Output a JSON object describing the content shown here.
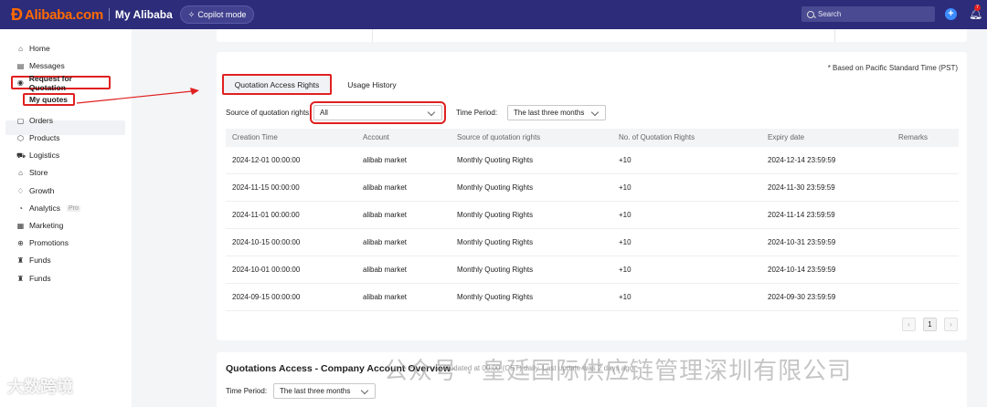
{
  "header": {
    "brand_mark": "Ɖ",
    "brand": "Alibaba.com",
    "title": "My Alibaba",
    "copilot_label": "Copilot mode",
    "search_placeholder": "Search",
    "notification_count": "7"
  },
  "sidebar": {
    "items": [
      {
        "label": "Home",
        "icon": "home-icon"
      },
      {
        "label": "Messages",
        "icon": "messages-icon"
      },
      {
        "label": "Request for Quotation",
        "icon": "rfq-icon"
      },
      {
        "label": "My quotes"
      },
      {
        "label": "Orders",
        "icon": "orders-icon"
      },
      {
        "label": "Products",
        "icon": "products-icon"
      },
      {
        "label": "Logistics",
        "icon": "logistics-icon"
      },
      {
        "label": "Store",
        "icon": "store-icon"
      },
      {
        "label": "Growth",
        "icon": "growth-icon"
      },
      {
        "label": "Analytics",
        "icon": "analytics-icon",
        "badge": "Pro"
      },
      {
        "label": "Marketing",
        "icon": "marketing-icon"
      },
      {
        "label": "Promotions",
        "icon": "promotions-icon"
      },
      {
        "label": "Funds",
        "icon": "funds-icon"
      },
      {
        "label": "Funds",
        "icon": "funds-icon"
      }
    ]
  },
  "main": {
    "pst_note": "* Based on Pacific Standard Time (PST)",
    "tabs": [
      {
        "label": "Quotation Access Rights",
        "active": true
      },
      {
        "label": "Usage History",
        "active": false
      }
    ],
    "filters": {
      "source_label": "Source of quotation rights:",
      "source_value": "All",
      "period_label": "Time Period:",
      "period_value": "The last three months"
    },
    "table": {
      "columns": [
        "Creation Time",
        "Account",
        "Source of quotation rights",
        "No. of Quotation Rights",
        "Expiry date",
        "Remarks"
      ],
      "rows": [
        [
          "2024-12-01 00:00:00",
          "alibab market",
          "Monthly Quoting Rights",
          "+10",
          "2024-12-14 23:59:59",
          ""
        ],
        [
          "2024-11-15 00:00:00",
          "alibab market",
          "Monthly Quoting Rights",
          "+10",
          "2024-11-30 23:59:59",
          ""
        ],
        [
          "2024-11-01 00:00:00",
          "alibab market",
          "Monthly Quoting Rights",
          "+10",
          "2024-11-14 23:59:59",
          ""
        ],
        [
          "2024-10-15 00:00:00",
          "alibab market",
          "Monthly Quoting Rights",
          "+10",
          "2024-10-31 23:59:59",
          ""
        ],
        [
          "2024-10-01 00:00:00",
          "alibab market",
          "Monthly Quoting Rights",
          "+10",
          "2024-10-14 23:59:59",
          ""
        ],
        [
          "2024-09-15 00:00:00",
          "alibab market",
          "Monthly Quoting Rights",
          "+10",
          "2024-09-30 23:59:59",
          ""
        ]
      ]
    },
    "pagination": {
      "prev": "‹",
      "current": "1",
      "next": "›"
    }
  },
  "overview": {
    "title": "Quotations Access - Company Account Overview",
    "subtitle": "Updated at 00:00 (CST) daily. Last update was 2 days ago",
    "period_label": "Time Period:",
    "period_value": "The last three months"
  },
  "watermarks": {
    "left": "大数跨境",
    "center": "公众号 · 皇廷国际供应链管理深圳有限公司"
  },
  "colors": {
    "header_bg": "#2c2c7a",
    "brand": "#ff6a00",
    "highlight": "#e02020"
  }
}
